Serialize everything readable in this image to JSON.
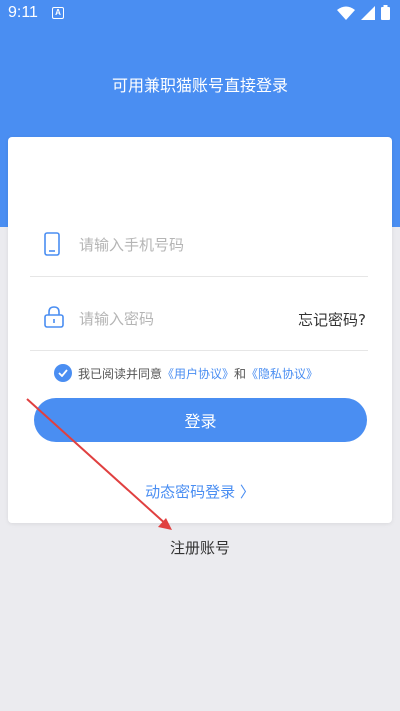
{
  "status_bar": {
    "time": "9:11",
    "notification_glyph": "A",
    "icons": [
      "wifi-icon",
      "signal-icon",
      "battery-icon"
    ]
  },
  "header": {
    "title": "可用兼职猫账号直接登录",
    "bg_color": "#4a8ef2"
  },
  "form": {
    "phone_placeholder": "请输入手机号码",
    "password_placeholder": "请输入密码",
    "forgot_label": "忘记密码?",
    "agreement": {
      "checked": true,
      "prefix": "我已阅读并同意",
      "user_agreement": "《用户协议》",
      "conjunction": "和",
      "privacy_agreement": "《隐私协议》"
    },
    "login_label": "登录",
    "dynamic_login_label": "动态密码登录 〉"
  },
  "register_label": "注册账号",
  "colors": {
    "accent": "#4a8ef2",
    "annotation_arrow": "#e04040"
  }
}
